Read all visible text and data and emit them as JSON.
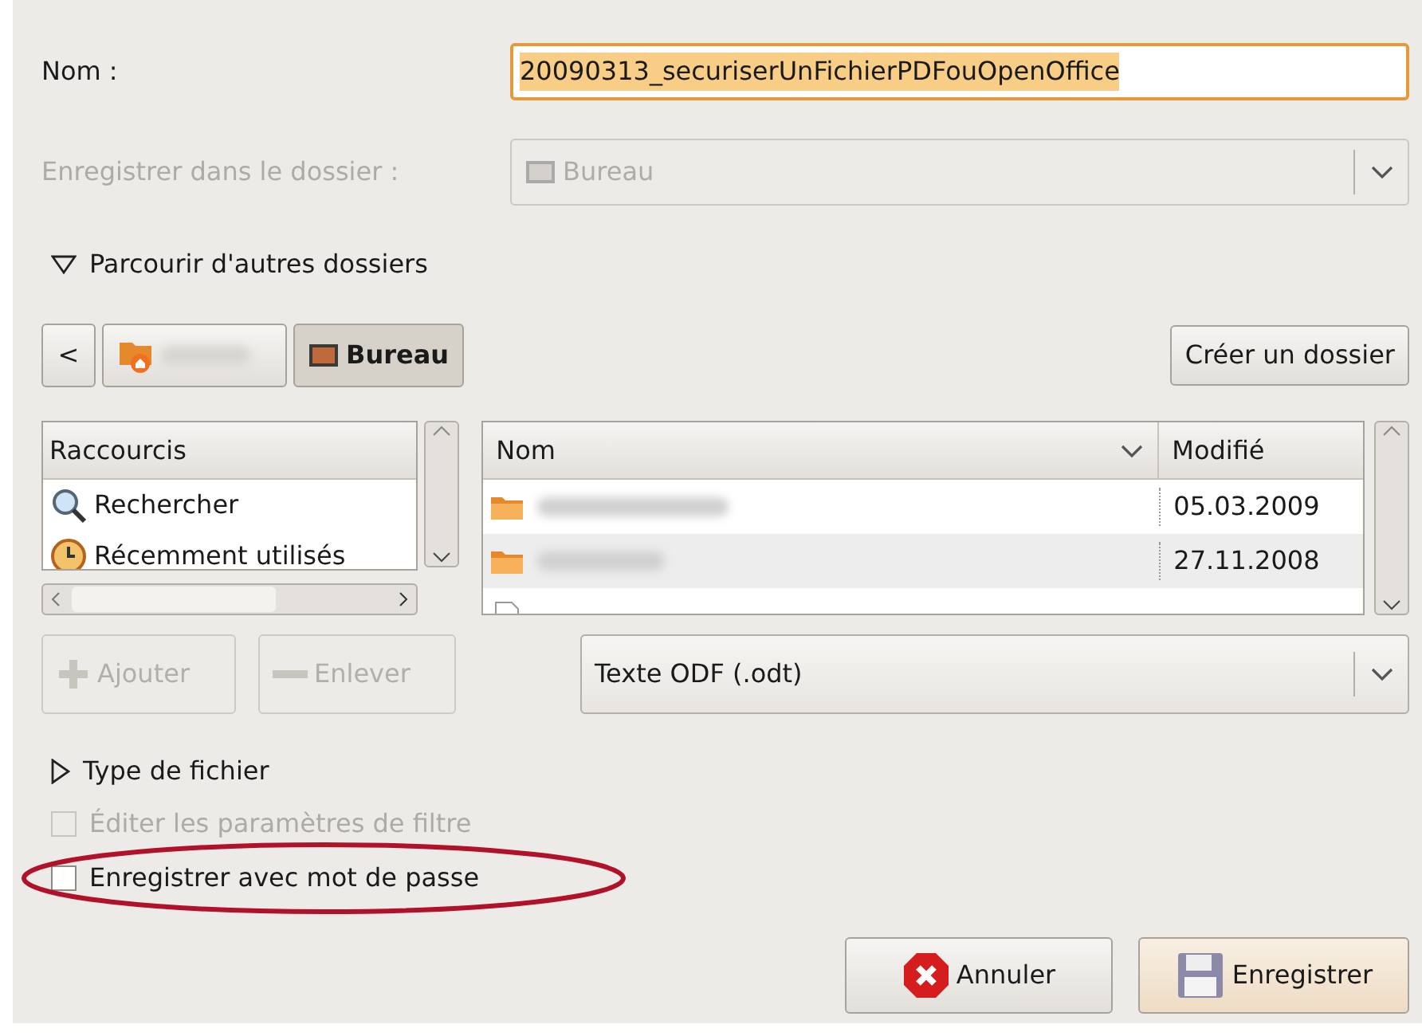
{
  "name_field": {
    "label": "Nom :",
    "value": "20090313_securiserUnFichierPDFouOpenOffice",
    "selected": true
  },
  "folder_select": {
    "label": "Enregistrer dans le dossier :",
    "value": "Bureau",
    "disabled": true
  },
  "browse_expander": {
    "label": "Parcourir d'autres dossiers",
    "expanded": true
  },
  "path_bar": [
    {
      "kind": "back",
      "label": "<"
    },
    {
      "kind": "home",
      "selected": false
    },
    {
      "kind": "desktop",
      "label": "Bureau",
      "selected": true
    }
  ],
  "create_folder_button": "Créer un dossier",
  "shortcuts": {
    "heading": "Raccourcis",
    "items": [
      {
        "kind": "search",
        "label": "Rechercher"
      },
      {
        "kind": "recent",
        "label": "Récemment utilisés"
      }
    ]
  },
  "files": {
    "columns": [
      "Nom",
      "Modifié"
    ],
    "rows": [
      {
        "kind": "folder",
        "modified": "05.03.2009",
        "selected": false
      },
      {
        "kind": "folder",
        "modified": "27.11.2008",
        "selected": false
      },
      {
        "kind": "file",
        "selected": false
      }
    ]
  },
  "add_button": {
    "label": "Ajouter",
    "disabled": true
  },
  "remove_button": {
    "label": "Enlever",
    "disabled": true
  },
  "filter_select": {
    "value": "Texte ODF (.odt)"
  },
  "type_expander": {
    "label": "Type de fichier",
    "expanded": false
  },
  "options": [
    {
      "label": "Éditer les paramètres de filtre",
      "checked": false,
      "disabled": true,
      "highlighted": false
    },
    {
      "label": "Enregistrer avec mot de passe",
      "checked": false,
      "disabled": false,
      "highlighted": true
    }
  ],
  "buttons": [
    {
      "kind": "cancel",
      "label": "Annuler"
    },
    {
      "kind": "save",
      "label": "Enregistrer"
    }
  ]
}
